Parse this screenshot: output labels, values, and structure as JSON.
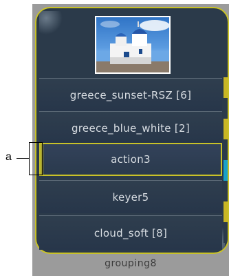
{
  "rows": [
    {
      "label": "greece_sunset-RSZ [6]"
    },
    {
      "label": "greece_blue_white [2]"
    },
    {
      "label": "action3",
      "selected": true
    },
    {
      "label": "keyer5"
    },
    {
      "label": "cloud_soft [8]"
    }
  ],
  "footer": {
    "label": "grouping8"
  },
  "callout": {
    "label": "a"
  },
  "colors": {
    "frame_border": "#c9c228",
    "row_bg": "#2b3a4a",
    "row_text": "#d8dde2",
    "panel_bg": "#9b9b9b"
  },
  "icons": [
    "thumbnail-image"
  ]
}
